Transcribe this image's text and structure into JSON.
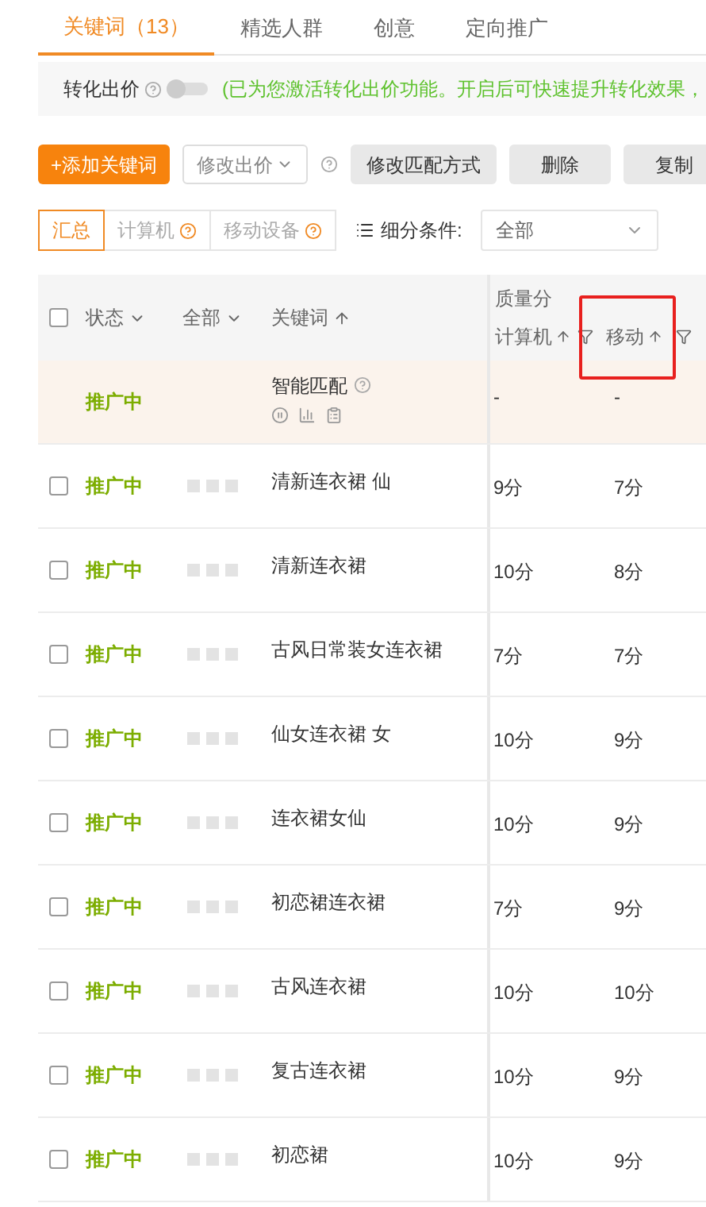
{
  "tabs": [
    {
      "label": "关键词（13）",
      "selected": true
    },
    {
      "label": "精选人群",
      "selected": false
    },
    {
      "label": "创意",
      "selected": false
    },
    {
      "label": "定向推广",
      "selected": false
    }
  ],
  "conversion_bid": {
    "label": "转化出价",
    "on": false,
    "note": "(已为您激活转化出价功能。开启后可快速提升转化效果，"
  },
  "toolbar": {
    "add_button": "+添加关键词",
    "bid_dropdown": "修改出价",
    "buttons": [
      "修改匹配方式",
      "删除",
      "复制"
    ]
  },
  "segments": [
    {
      "label": "汇总",
      "selected": true,
      "help": false
    },
    {
      "label": "计算机",
      "selected": false,
      "help": true
    },
    {
      "label": "移动设备",
      "selected": false,
      "help": true
    }
  ],
  "filter": {
    "label": "细分条件:",
    "value": "全部"
  },
  "table": {
    "select_all": {
      "checked": false
    },
    "columns": {
      "status": "状态",
      "all": "全部",
      "keyword": "关键词",
      "quality": "质量分",
      "computer": "计算机",
      "mobile": "移动"
    },
    "rows": [
      {
        "kind": "smart",
        "status": "推广中",
        "keyword": "智能匹配",
        "computer": "-",
        "mobile": "-"
      },
      {
        "kind": "keyword",
        "checked": false,
        "status": "推广中",
        "keyword": "清新连衣裙 仙",
        "computer": "9分",
        "mobile": "7分"
      },
      {
        "kind": "keyword",
        "checked": false,
        "status": "推广中",
        "keyword": "清新连衣裙",
        "computer": "10分",
        "mobile": "8分"
      },
      {
        "kind": "keyword",
        "checked": false,
        "status": "推广中",
        "keyword": "古风日常装女连衣裙",
        "computer": "7分",
        "mobile": "7分"
      },
      {
        "kind": "keyword",
        "checked": false,
        "status": "推广中",
        "keyword": "仙女连衣裙 女",
        "computer": "10分",
        "mobile": "9分"
      },
      {
        "kind": "keyword",
        "checked": false,
        "status": "推广中",
        "keyword": "连衣裙女仙",
        "computer": "10分",
        "mobile": "9分"
      },
      {
        "kind": "keyword",
        "checked": false,
        "status": "推广中",
        "keyword": "初恋裙连衣裙",
        "computer": "7分",
        "mobile": "9分"
      },
      {
        "kind": "keyword",
        "checked": false,
        "status": "推广中",
        "keyword": "古风连衣裙",
        "computer": "10分",
        "mobile": "10分"
      },
      {
        "kind": "keyword",
        "checked": false,
        "status": "推广中",
        "keyword": "复古连衣裙",
        "computer": "10分",
        "mobile": "9分"
      },
      {
        "kind": "keyword",
        "checked": false,
        "status": "推广中",
        "keyword": "初恋裙",
        "computer": "10分",
        "mobile": "9分"
      }
    ]
  }
}
